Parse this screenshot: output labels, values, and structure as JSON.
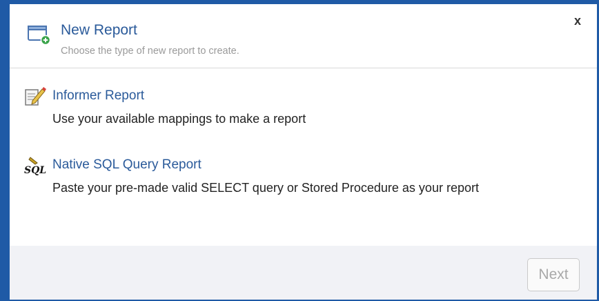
{
  "dialog": {
    "title": "New Report",
    "subtitle": "Choose the type of new report to create.",
    "close_label": "x",
    "header_icon": "new-window-icon"
  },
  "options": [
    {
      "icon": "report-edit-icon",
      "title": "Informer Report",
      "description": "Use your available mappings to make a report"
    },
    {
      "icon": "sql-icon",
      "title": "Native SQL Query Report",
      "description": "Paste your pre-made valid SELECT query or Stored Procedure as your report"
    }
  ],
  "footer": {
    "next_label": "Next",
    "next_enabled": false
  },
  "colors": {
    "border": "#1f5aa6",
    "link": "#2a5a9a",
    "footer_bg": "#f1f2f6"
  }
}
